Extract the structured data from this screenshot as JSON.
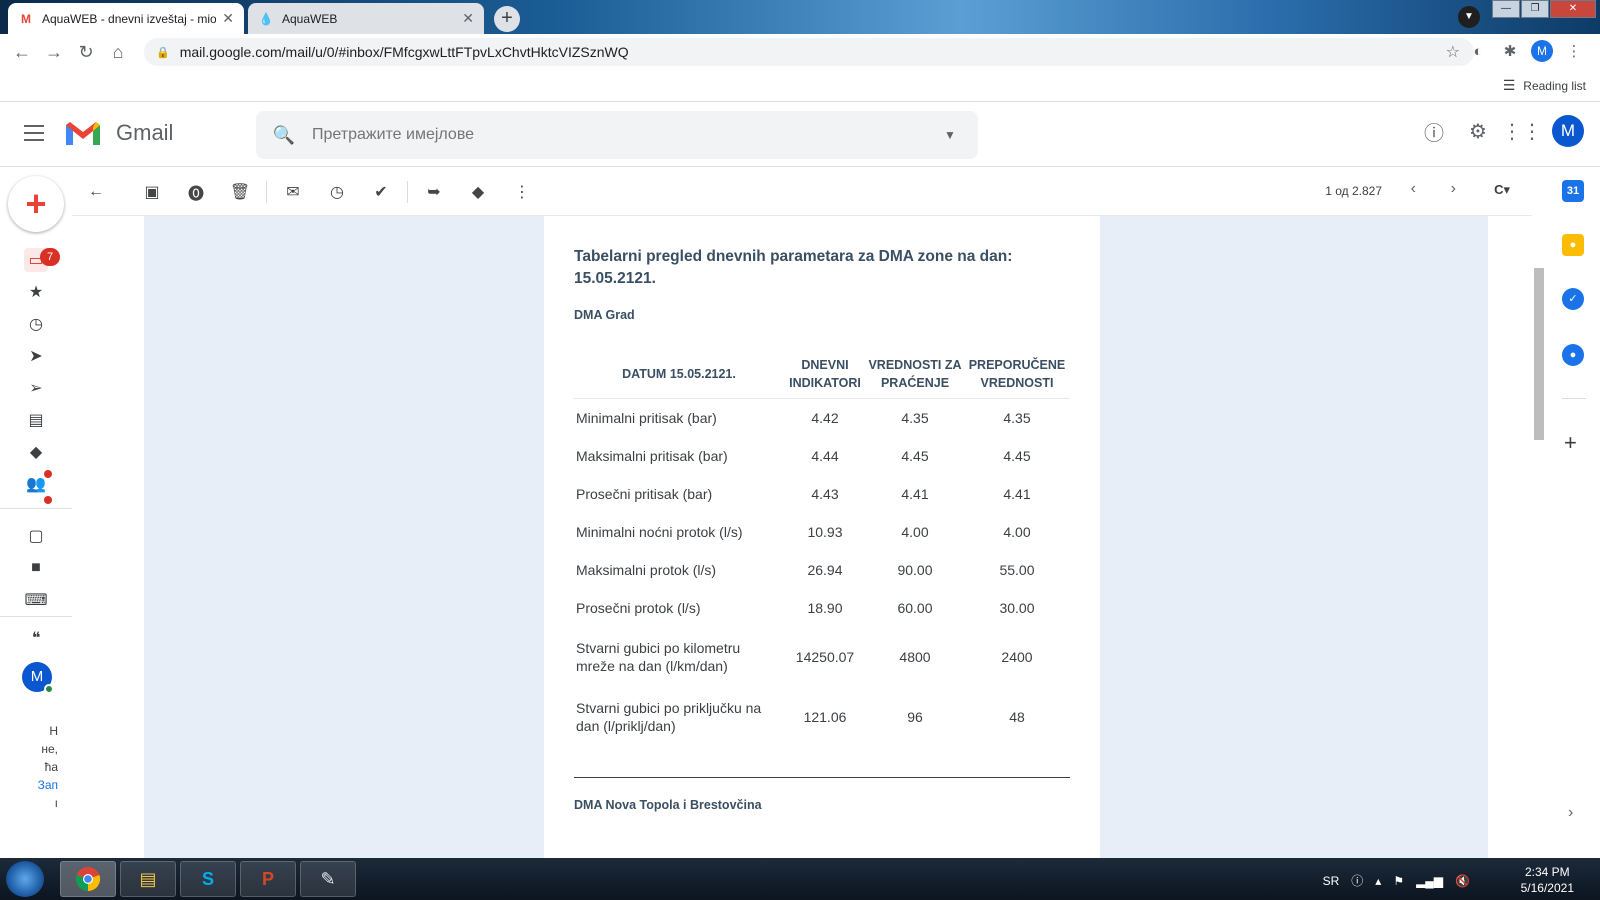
{
  "browser": {
    "tabs": [
      {
        "title": "AquaWEB - dnevni izveštaj - mio",
        "favicon": "gmail-icon"
      },
      {
        "title": "AquaWEB",
        "favicon": "water-drop-icon"
      }
    ],
    "url": "mail.google.com/mail/u/0/#inbox/FMfcgxwLttFTpvLxChvtHktcVIZSznWQ",
    "profile_initial": "M",
    "reading_list": "Reading list"
  },
  "gmail": {
    "wordmark": "Gmail",
    "search_placeholder": "Претражите имејлове",
    "avatar_initial": "M",
    "inbox_badge": "7",
    "rail_avatar_initial": "M",
    "rail_text": [
      "Н",
      "не,",
      "ћа",
      "Зап",
      "ı"
    ],
    "pager": "1 од 2.827",
    "lang": "C"
  },
  "email": {
    "title": "Tabelarni pregled dnevnih parametara za DMA zone na dan: 15.05.2121.",
    "zone1": "DMA Grad",
    "zone2": "DMA Nova Topola i Brestovčina",
    "headers": [
      "DATUM 15.05.2121.",
      "DNEVNI INDIKATORI",
      "VREDNOSTI ZA PRAĆENJE",
      "PREPORUČENE VREDNOSTI"
    ],
    "rows": [
      {
        "label": "Minimalni pritisak (bar)",
        "daily": "4.42",
        "monitor": "4.35",
        "recommended": "4.35"
      },
      {
        "label": "Maksimalni pritisak (bar)",
        "daily": "4.44",
        "monitor": "4.45",
        "recommended": "4.45"
      },
      {
        "label": "Prosečni pritisak (bar)",
        "daily": "4.43",
        "monitor": "4.41",
        "recommended": "4.41"
      },
      {
        "label": "Minimalni noćni protok (l/s)",
        "daily": "10.93",
        "monitor": "4.00",
        "recommended": "4.00"
      },
      {
        "label": "Maksimalni protok (l/s)",
        "daily": "26.94",
        "monitor": "90.00",
        "recommended": "55.00"
      },
      {
        "label": "Prosečni protok (l/s)",
        "daily": "18.90",
        "monitor": "60.00",
        "recommended": "30.00"
      },
      {
        "label": "Stvarni gubici po kilometru mreže na dan (l/km/dan)",
        "daily": "14250.07",
        "monitor": "4800",
        "recommended": "2400"
      },
      {
        "label": "Stvarni gubici po priključku na dan (l/priklj/dan)",
        "daily": "121.06",
        "monitor": "96",
        "recommended": "48"
      }
    ]
  },
  "taskbar": {
    "lang": "SR",
    "time": "2:34 PM",
    "date": "5/16/2021"
  },
  "colors": {
    "accent": "#1a73e8",
    "badge": "#d93025",
    "email_bg": "#e8eef8",
    "heading": "#3a4f63"
  }
}
